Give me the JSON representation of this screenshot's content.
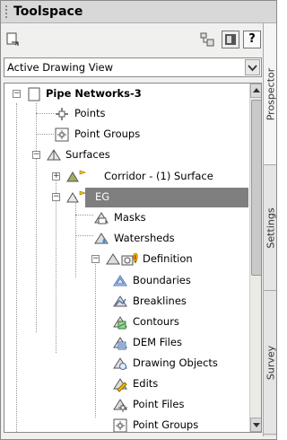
{
  "title": "Toolspace",
  "toolbar": {
    "refresh_icon": "refresh-icon",
    "item_view_icon": "item-view-icon",
    "list_view_icon": "list-view-icon",
    "help_label": "?"
  },
  "view_selector": {
    "value": "Active Drawing View"
  },
  "tree": {
    "root": "Pipe Networks-3",
    "points": "Points",
    "point_groups": "Point Groups",
    "surfaces": "Surfaces",
    "corridor_surface": "Corridor - (1) Surface",
    "eg": "EG",
    "masks": "Masks",
    "watersheds": "Watersheds",
    "definition": "Definition",
    "boundaries": "Boundaries",
    "breaklines": "Breaklines",
    "contours": "Contours",
    "dem_files": "DEM Files",
    "drawing_objects": "Drawing Objects",
    "edits": "Edits",
    "point_files": "Point Files",
    "def_point_groups": "Point Groups"
  },
  "side_tabs": {
    "prospector": "Prospector",
    "settings": "Settings",
    "survey": "Survey"
  },
  "colors": {
    "selected_row": "#7f7f7f",
    "warning": "#f5c400",
    "surface_icon": "#4a6fb0"
  }
}
